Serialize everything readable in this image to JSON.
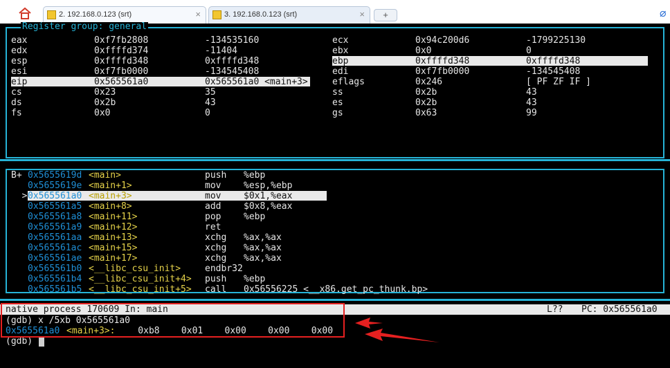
{
  "tabs": [
    {
      "label": "2. 192.168.0.123 (srt)",
      "active": true
    },
    {
      "label": "3. 192.168.0.123 (srt)",
      "active": false
    }
  ],
  "regs": {
    "title": "Register group: general",
    "left": [
      [
        "eax",
        "0xf7fb2808",
        "-134535160"
      ],
      [
        "edx",
        "0xffffd374",
        "-11404"
      ],
      [
        "esp",
        "0xffffd348",
        "0xffffd348"
      ],
      [
        "esi",
        "0xf7fb0000",
        "-134545408"
      ],
      [
        "eip",
        "0x565561a0",
        "0x565561a0 <main+3>"
      ],
      [
        "cs",
        "0x23",
        "35"
      ],
      [
        "ds",
        "0x2b",
        "43"
      ],
      [
        "fs",
        "0x0",
        "0"
      ]
    ],
    "right": [
      [
        "ecx",
        "0x94c200d6",
        "-1799225130"
      ],
      [
        "ebx",
        "0x0",
        "0"
      ],
      [
        "ebp",
        "0xffffd348",
        "0xffffd348"
      ],
      [
        "edi",
        "0xf7fb0000",
        "-134545408"
      ],
      [
        "eflags",
        "0x246",
        "[ PF ZF IF ]"
      ],
      [
        "ss",
        "0x2b",
        "43"
      ],
      [
        "es",
        "0x2b",
        "43"
      ],
      [
        "gs",
        "0x63",
        "99"
      ]
    ]
  },
  "asm": [
    {
      "prefix": "B+ ",
      "addr": "0x5655619d",
      "sym": "<main>",
      "op": "push",
      "args": "%ebp"
    },
    {
      "prefix": "   ",
      "addr": "0x5655619e",
      "sym": "<main+1>",
      "op": "mov",
      "args": "%esp,%ebp"
    },
    {
      "prefix": "  >",
      "addr": "0x565561a0",
      "sym": "<main+3>",
      "op": "mov",
      "args": "$0x1,%eax"
    },
    {
      "prefix": "   ",
      "addr": "0x565561a5",
      "sym": "<main+8>",
      "op": "add",
      "args": "$0x8,%eax"
    },
    {
      "prefix": "   ",
      "addr": "0x565561a8",
      "sym": "<main+11>",
      "op": "pop",
      "args": "%ebp"
    },
    {
      "prefix": "   ",
      "addr": "0x565561a9",
      "sym": "<main+12>",
      "op": "ret",
      "args": ""
    },
    {
      "prefix": "   ",
      "addr": "0x565561aa",
      "sym": "<main+13>",
      "op": "xchg",
      "args": "%ax,%ax"
    },
    {
      "prefix": "   ",
      "addr": "0x565561ac",
      "sym": "<main+15>",
      "op": "xchg",
      "args": "%ax,%ax"
    },
    {
      "prefix": "   ",
      "addr": "0x565561ae",
      "sym": "<main+17>",
      "op": "xchg",
      "args": "%ax,%ax"
    },
    {
      "prefix": "   ",
      "addr": "0x565561b0",
      "sym": "<__libc_csu_init>",
      "op": "endbr32",
      "args": ""
    },
    {
      "prefix": "   ",
      "addr": "0x565561b4",
      "sym": "<__libc_csu_init+4>",
      "op": "push",
      "args": "%ebp"
    },
    {
      "prefix": "   ",
      "addr": "0x565561b5",
      "sym": "<__libc_csu_init+5>",
      "op": "call",
      "args": "0x56556225 <__x86.get_pc_thunk.bp>"
    }
  ],
  "status": {
    "left": "native process 170609 In: main",
    "line": "L??",
    "pc": "PC: 0x565561a0"
  },
  "console": {
    "cmd": "(gdb) x /5xb 0x565561a0",
    "out_addr": "0x565561a0",
    "out_sym": "<main+3>:",
    "out_bytes": "    0xb8    0x01    0x00    0x00    0x00",
    "prompt": "(gdb) "
  },
  "colors": {
    "accent": "#26b3d7",
    "annotation": "#e62020",
    "sym": "#e6d34a",
    "addr": "#1f8fd6"
  }
}
